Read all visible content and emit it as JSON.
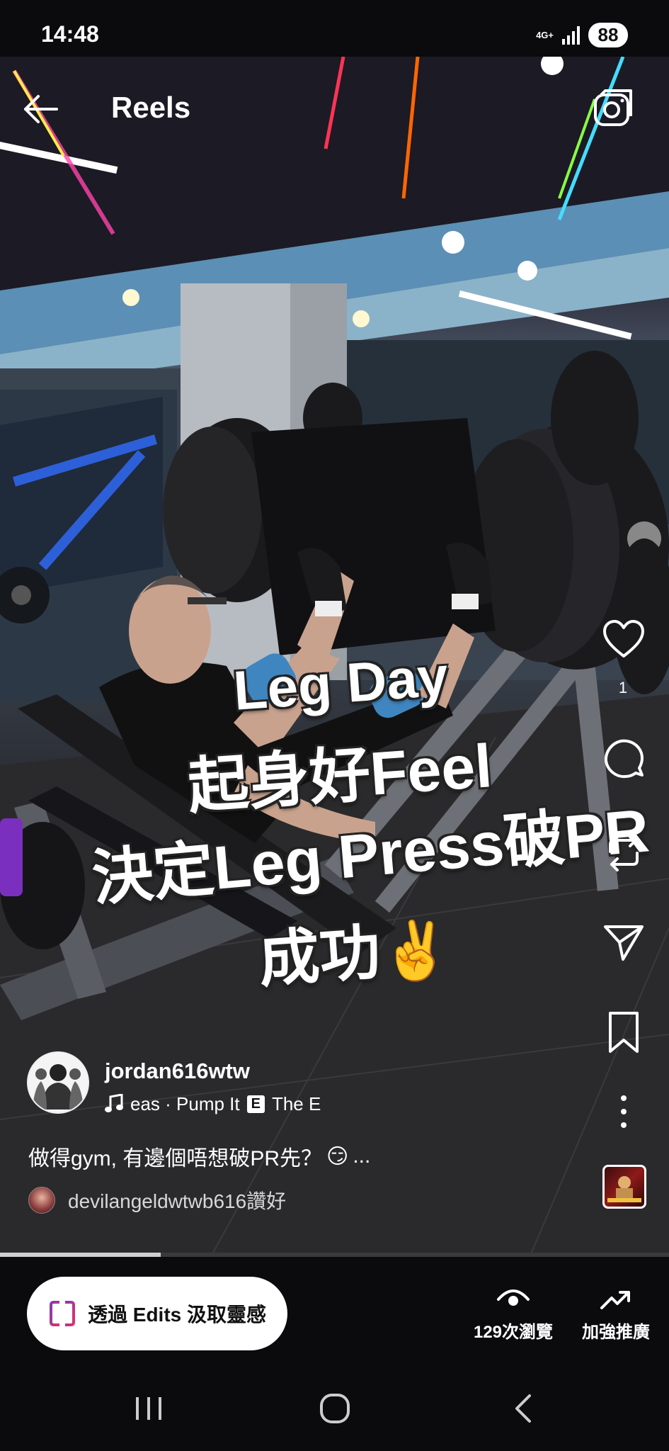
{
  "status_bar": {
    "time": "14:48",
    "network": "4G+",
    "battery": "88"
  },
  "header": {
    "title": "Reels",
    "back_icon": "arrow-left-icon",
    "camera_icon": "camera-icon"
  },
  "overlay_text": {
    "line1": "Leg Day",
    "line2": "起身好Feel",
    "line3": "決定Leg Press破PR",
    "line4": "成功",
    "emoji": "✌️"
  },
  "actions": {
    "like_count": "1",
    "icons": [
      "heart-icon",
      "comment-icon",
      "remix-icon",
      "share-icon",
      "bookmark-icon",
      "more-icon"
    ]
  },
  "post": {
    "author": "jordan616wtw",
    "music": "eas · Pump It",
    "music_trail": "The E",
    "explicit": "E",
    "caption": "做得gym, 有邊個唔想破PR先？",
    "caption_emoji": "😏",
    "caption_more": "...",
    "liked_by": "devilangeldwtwb616讚好"
  },
  "progress": {
    "value": 0.24
  },
  "bottom_bar": {
    "edits_label": "透過 Edits 汲取靈感",
    "views_label": "129次瀏覽",
    "boost_label": "加強推廣"
  },
  "colors": {
    "accent_edits_pink": "#e1306c",
    "accent_edits_purple": "#833ab4",
    "background": "#0b0b0e"
  }
}
